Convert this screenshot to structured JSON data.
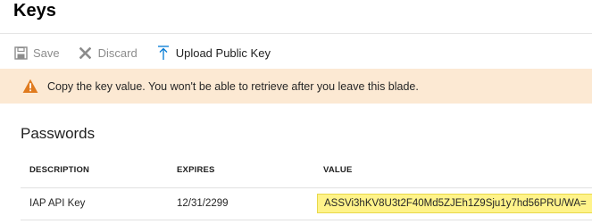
{
  "blade": {
    "title": "Keys"
  },
  "toolbar": {
    "save_label": "Save",
    "discard_label": "Discard",
    "upload_label": "Upload Public Key"
  },
  "warning": {
    "icon": "warning-icon",
    "message": "Copy the key value. You won't be able to retrieve after you leave this blade."
  },
  "passwords": {
    "title": "Passwords",
    "columns": [
      "DESCRIPTION",
      "EXPIRES",
      "VALUE"
    ],
    "rows": [
      {
        "description": "IAP API Key",
        "expires": "12/31/2299",
        "value": "ASSVi3hKV8U3t2F40Md5ZJEh1Z9Sju1y7hd56PRU/WA="
      }
    ]
  },
  "colors": {
    "warning_bg": "#fce9d3",
    "highlight": "#fff38a",
    "accent": "#0078d4"
  }
}
